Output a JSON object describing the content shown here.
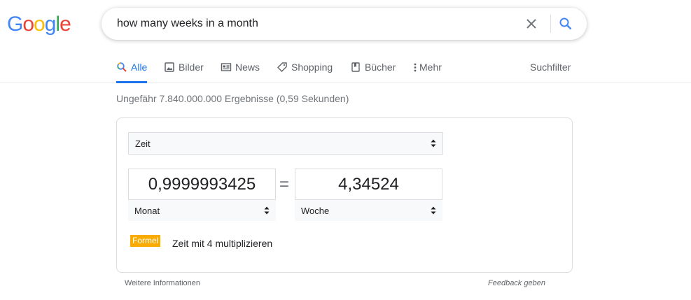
{
  "logo": {
    "letters": [
      "G",
      "o",
      "o",
      "g",
      "l",
      "e"
    ],
    "colors": [
      "#4285f4",
      "#ea4335",
      "#fbbc05",
      "#4285f4",
      "#34a853",
      "#ea4335"
    ]
  },
  "search": {
    "query": "how many weeks in a month",
    "clear_icon": "close-icon",
    "search_icon": "search-icon"
  },
  "tabs": [
    {
      "label": "Alle",
      "icon": "search-icon",
      "active": true
    },
    {
      "label": "Bilder",
      "icon": "image-icon",
      "active": false
    },
    {
      "label": "News",
      "icon": "news-icon",
      "active": false
    },
    {
      "label": "Shopping",
      "icon": "tag-icon",
      "active": false
    },
    {
      "label": "Bücher",
      "icon": "book-icon",
      "active": false
    },
    {
      "label": "Mehr",
      "icon": "more-vert-icon",
      "active": false
    }
  ],
  "suchfilter": "Suchfilter",
  "result_stats": "Ungefähr 7.840.000.000 Ergebnisse (0,59 Sekunden)",
  "converter": {
    "category": "Zeit",
    "left_value": "0,9999993425",
    "left_unit": "Monat",
    "equals": "=",
    "right_value": "4,34524",
    "right_unit": "Woche",
    "formula_badge": "Formel",
    "formula_text": "Zeit mit 4 multiplizieren"
  },
  "footer": {
    "more_info": "Weitere Informationen",
    "feedback": "Feedback geben"
  },
  "colors": {
    "accent": "#1a73e8",
    "badge": "#f9ab00"
  }
}
